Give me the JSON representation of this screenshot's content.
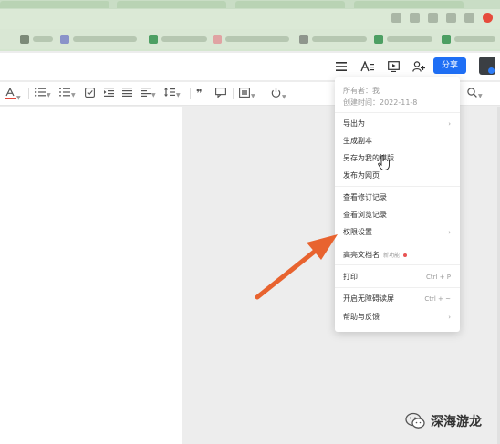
{
  "header": {
    "share_label": "分享"
  },
  "menu": {
    "owner_label": "所有者：我",
    "created_label": "创建时间：2022-11-8",
    "items": [
      {
        "label": "导出为",
        "arrow": "›"
      },
      {
        "label": "生成副本"
      },
      {
        "label": "另存为我的模版"
      },
      {
        "label": "发布为网页"
      },
      {
        "label": "查看修订记录"
      },
      {
        "label": "查看浏览记录"
      },
      {
        "label": "权限设置",
        "arrow": "›"
      },
      {
        "label": "高亮文档名",
        "tag": "新功能"
      },
      {
        "label": "打印",
        "shortcut": "Ctrl + P"
      },
      {
        "label": "开启无障碍读屏",
        "shortcut": "Ctrl + ~"
      },
      {
        "label": "帮助与反馈",
        "arrow": "›"
      }
    ]
  },
  "watermark": {
    "text": "深海游龙"
  },
  "colors": {
    "accent": "#1f6ff5",
    "annotation_arrow": "#e8632f",
    "font_color_underline": "#e0463a"
  },
  "icons": {
    "header": [
      "menu-icon",
      "text-style-icon",
      "present-icon",
      "add-user-icon"
    ],
    "toolbar": [
      "font-color-icon",
      "bullet-list-icon",
      "numbered-list-icon",
      "checklist-icon",
      "indent-icon",
      "align-icon",
      "align-left-icon",
      "line-spacing-icon",
      "quote-icon",
      "comment-icon",
      "insert-image-icon",
      "attachment-icon",
      "search-icon"
    ]
  }
}
